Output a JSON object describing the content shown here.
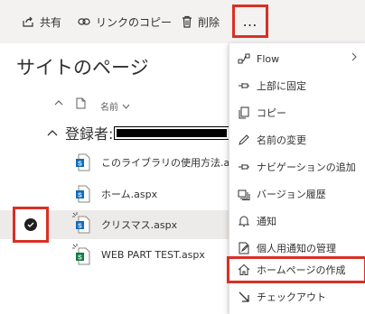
{
  "toolbar": {
    "share_label": "共有",
    "copy_link_label": "リンクのコピー",
    "delete_label": "削除",
    "more_label": "…"
  },
  "page": {
    "title": "サイトのページ"
  },
  "list": {
    "column_name": "名前",
    "group_label": "登録者:",
    "files": [
      {
        "name": "このライブラリの使用方法.a",
        "selected": false
      },
      {
        "name": "ホーム.aspx",
        "selected": false
      },
      {
        "name": "クリスマス.aspx",
        "selected": true
      },
      {
        "name": "WEB PART TEST.aspx",
        "selected": false
      }
    ]
  },
  "menu": {
    "items": [
      {
        "label": "Flow",
        "icon": "flow-icon",
        "has_submenu": true
      },
      {
        "label": "上部に固定",
        "icon": "pin-icon"
      },
      {
        "label": "コピー",
        "icon": "copy-icon"
      },
      {
        "label": "名前の変更",
        "icon": "rename-icon"
      },
      {
        "label": "ナビゲーションの追加",
        "icon": "pin-icon"
      },
      {
        "label": "バージョン履歴",
        "icon": "version-history-icon"
      },
      {
        "label": "通知",
        "icon": "bell-icon"
      },
      {
        "label": "個人用通知の管理",
        "icon": "manage-alerts-icon"
      },
      {
        "label": "ホームページの作成",
        "icon": "home-icon",
        "highlighted": true
      },
      {
        "label": "チェックアウト",
        "icon": "checkout-icon"
      }
    ]
  },
  "colors": {
    "highlight_red": "#d93025",
    "toolbar_bg": "#f3f2f1",
    "selected_row_bg": "#edebe9"
  }
}
